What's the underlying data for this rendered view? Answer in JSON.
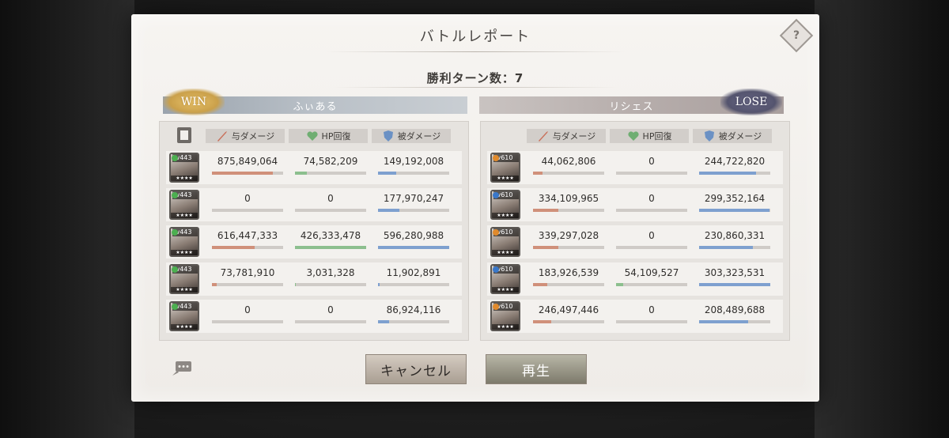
{
  "title": "バトルレポート",
  "turns_label": "勝利ターン数：7",
  "left_team": {
    "result": "WIN",
    "name": "ふぃある",
    "headers": {
      "dealt": "与ダメージ",
      "heal": "HP回復",
      "taken": "被ダメージ"
    },
    "members": [
      {
        "level": "Lv443",
        "element_color": "#4caf50",
        "dealt": "875,849,064",
        "heal": "74,582,209",
        "taken": "149,192,008",
        "dealt_ratio": 0.86,
        "heal_ratio": 0.17,
        "taken_ratio": 0.25
      },
      {
        "level": "Lv443",
        "element_color": "#4caf50",
        "dealt": "0",
        "heal": "0",
        "taken": "177,970,247",
        "dealt_ratio": 0.0,
        "heal_ratio": 0.0,
        "taken_ratio": 0.3
      },
      {
        "level": "Lv443",
        "element_color": "#4caf50",
        "dealt": "616,447,333",
        "heal": "426,333,478",
        "taken": "596,280,988",
        "dealt_ratio": 0.6,
        "heal_ratio": 1.0,
        "taken_ratio": 1.0
      },
      {
        "level": "Lv443",
        "element_color": "#4caf50",
        "dealt": "73,781,910",
        "heal": "3,031,328",
        "taken": "11,902,891",
        "dealt_ratio": 0.07,
        "heal_ratio": 0.01,
        "taken_ratio": 0.02
      },
      {
        "level": "Lv443",
        "element_color": "#4caf50",
        "dealt": "0",
        "heal": "0",
        "taken": "86,924,116",
        "dealt_ratio": 0.0,
        "heal_ratio": 0.0,
        "taken_ratio": 0.15
      }
    ]
  },
  "right_team": {
    "result": "LOSE",
    "name": "リシェス",
    "headers": {
      "dealt": "与ダメージ",
      "heal": "HP回復",
      "taken": "被ダメージ"
    },
    "members": [
      {
        "level": "Lv610",
        "element_color": "#e08a2c",
        "dealt": "44,062,806",
        "heal": "0",
        "taken": "244,722,820",
        "dealt_ratio": 0.13,
        "heal_ratio": 0.0,
        "taken_ratio": 0.8
      },
      {
        "level": "Lv610",
        "element_color": "#3a78c9",
        "dealt": "334,109,965",
        "heal": "0",
        "taken": "299,352,164",
        "dealt_ratio": 0.35,
        "heal_ratio": 0.0,
        "taken_ratio": 0.99
      },
      {
        "level": "Lv610",
        "element_color": "#e08a2c",
        "dealt": "339,297,028",
        "heal": "0",
        "taken": "230,860,331",
        "dealt_ratio": 0.36,
        "heal_ratio": 0.0,
        "taken_ratio": 0.76
      },
      {
        "level": "Lv610",
        "element_color": "#3a78c9",
        "dealt": "183,926,539",
        "heal": "54,109,527",
        "taken": "303,323,531",
        "dealt_ratio": 0.2,
        "heal_ratio": 0.1,
        "taken_ratio": 1.0
      },
      {
        "level": "Lv610",
        "element_color": "#e08a2c",
        "dealt": "246,497,446",
        "heal": "0",
        "taken": "208,489,688",
        "dealt_ratio": 0.26,
        "heal_ratio": 0.0,
        "taken_ratio": 0.69
      }
    ]
  },
  "buttons": {
    "cancel": "キャンセル",
    "play": "再生"
  },
  "icons": {
    "help": "help-icon",
    "report": "report-icon",
    "chat": "chat-icon",
    "dealt": "sword-icon",
    "heal": "heart-icon",
    "taken": "shield-icon"
  },
  "colors": {
    "dealt_bar": "#d0907a",
    "heal_bar": "#8cbf8e",
    "taken_bar": "#7ea0cf",
    "win_badge": "#caa04a",
    "lose_badge": "#54546e"
  }
}
